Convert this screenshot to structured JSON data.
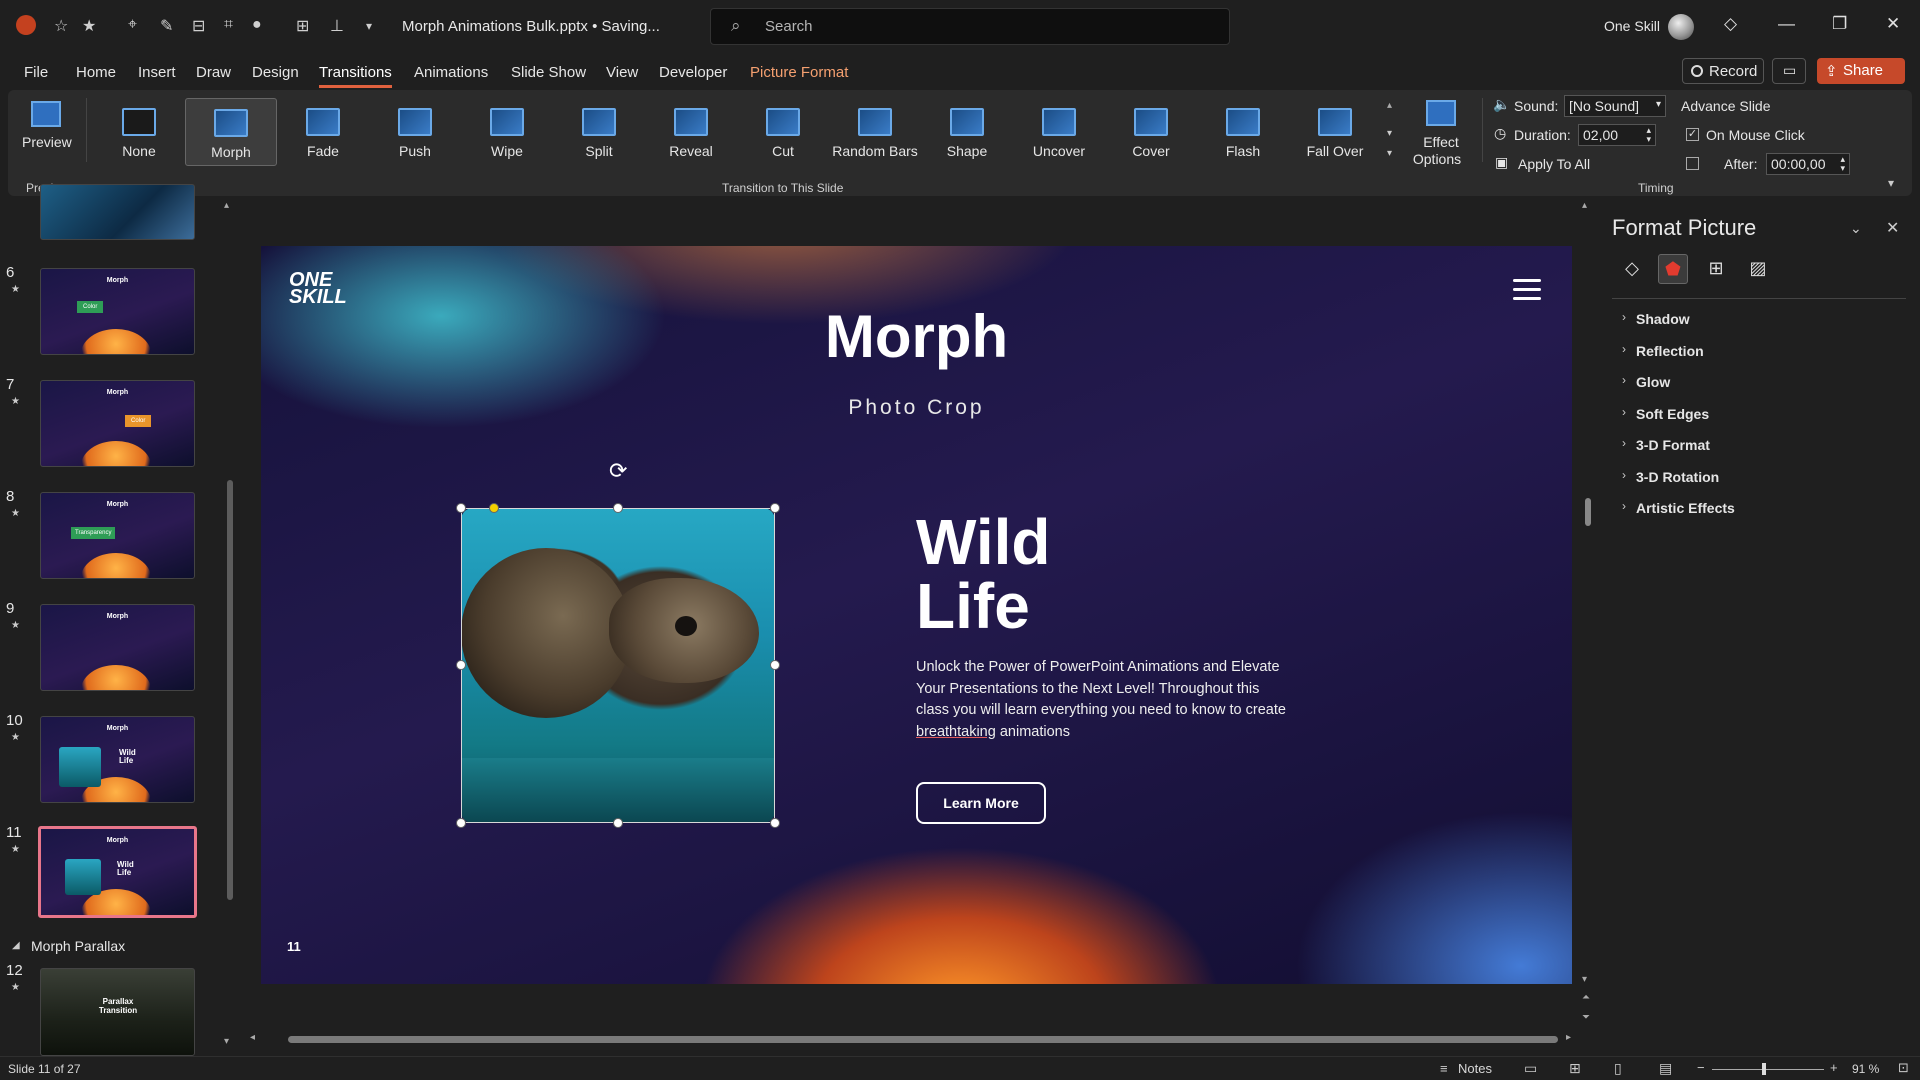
{
  "titlebar": {
    "doc_title": "Morph Animations Bulk.pptx • Saving...",
    "search_placeholder": "Search",
    "user_name": "One Skill"
  },
  "menu": {
    "tabs": [
      "File",
      "Home",
      "Insert",
      "Draw",
      "Design",
      "Transitions",
      "Animations",
      "Slide Show",
      "View",
      "Developer",
      "Picture Format"
    ],
    "active": "Transitions",
    "record": "Record",
    "share": "Share"
  },
  "ribbon": {
    "preview_label": "Preview",
    "preview_group": "Preview",
    "transitions": [
      "None",
      "Morph",
      "Fade",
      "Push",
      "Wipe",
      "Split",
      "Reveal",
      "Cut",
      "Random Bars",
      "Shape",
      "Uncover",
      "Cover",
      "Flash",
      "Fall Over"
    ],
    "selected_transition": "Morph",
    "effect_options_1": "Effect",
    "effect_options_2": "Options",
    "group_label": "Transition to This Slide",
    "sound_label": "Sound:",
    "sound_value": "[No Sound]",
    "duration_label": "Duration:",
    "duration_value": "02,00",
    "apply_all": "Apply To All",
    "advance_slide": "Advance Slide",
    "on_mouse_click": "On Mouse Click",
    "after_label": "After:",
    "after_value": "00:00,00",
    "timing_group": "Timing"
  },
  "thumbnails": {
    "items": [
      {
        "num": "6",
        "title": "Morph",
        "tag": "Color"
      },
      {
        "num": "7",
        "title": "Morph",
        "tag": "Color"
      },
      {
        "num": "8",
        "title": "Morph",
        "tag": "Transparency"
      },
      {
        "num": "9",
        "title": "Morph",
        "tag": ""
      },
      {
        "num": "10",
        "title": "Morph",
        "tag": "Wild Life"
      },
      {
        "num": "11",
        "title": "Morph",
        "tag": "Wild Life"
      },
      {
        "num": "12",
        "title": "Parallax Transition",
        "tag": ""
      }
    ],
    "section_label": "Morph Parallax",
    "selected": "11"
  },
  "slide": {
    "logo_line1": "ONE",
    "logo_line2": "SKILL",
    "title": "Morph",
    "subtitle": "Photo Crop",
    "headline_1": "Wild",
    "headline_2": "Life",
    "body_1": "Unlock the Power of PowerPoint Animations and Elevate Your Presentations to the Next Level! Throughout this class you will learn everything you need to know to create ",
    "body_underlined": "breathtaking",
    "body_2": " animations",
    "button": "Learn More",
    "page_number": "11"
  },
  "format_pane": {
    "title": "Format Picture",
    "sections": [
      "Shadow",
      "Reflection",
      "Glow",
      "Soft Edges",
      "3-D Format",
      "3-D Rotation",
      "Artistic Effects"
    ]
  },
  "status": {
    "slide_of": "Slide 11 of 27",
    "notes": "Notes",
    "zoom": "91 %"
  },
  "colors": {
    "accent": "#c6492a",
    "selected_thumb": "#e8768a",
    "picture_format_tab": "#f5a070"
  }
}
